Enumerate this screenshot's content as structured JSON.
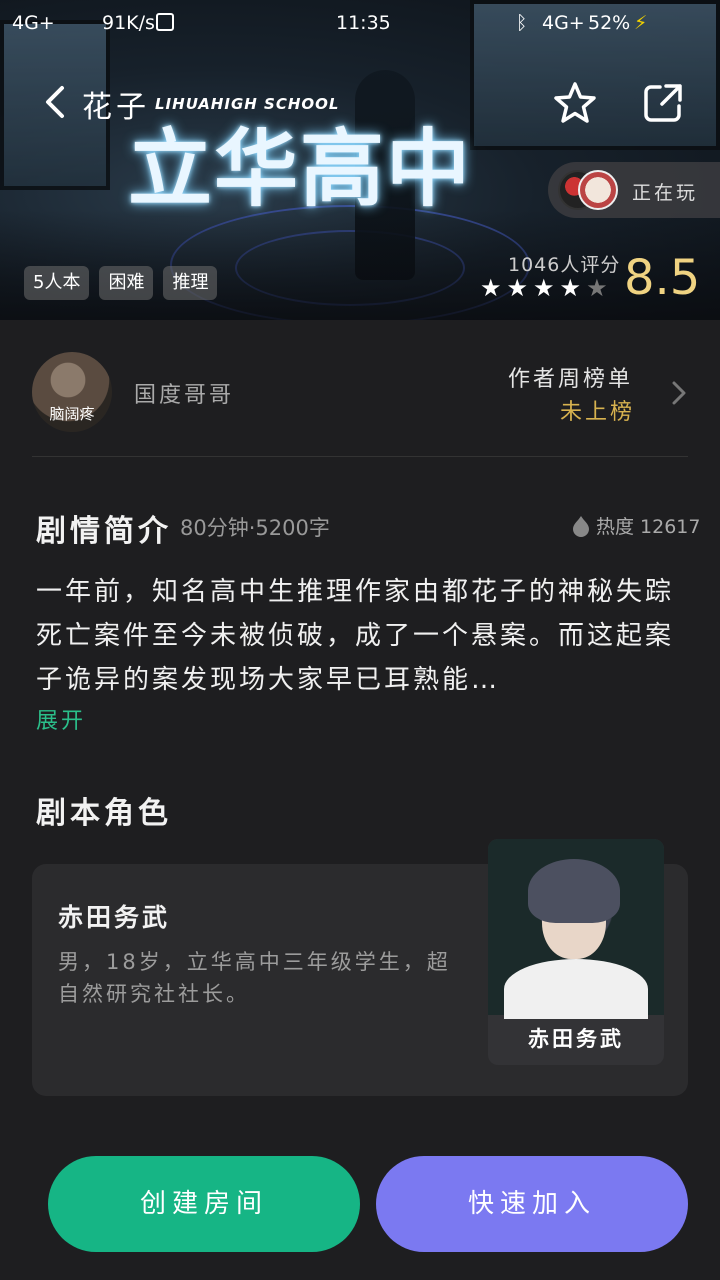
{
  "status_bar": {
    "network_left": "4G+",
    "speed": "91K/s",
    "time": "11:35",
    "network_right": "4G+",
    "battery": "52%"
  },
  "header": {
    "back_label": "花子",
    "subtitle": "LIHUAHIGH SCHOOL",
    "title": "立华高中",
    "now_playing": "正在玩",
    "tags": [
      "5人本",
      "困难",
      "推理"
    ],
    "rating_count": "1046人评分",
    "stars_on": 4,
    "stars_total": 5,
    "score": "8.5"
  },
  "author": {
    "avatar_text": "脑阔疼",
    "name": "国度哥哥",
    "weekly_label": "作者周榜单",
    "weekly_value": "未上榜"
  },
  "synopsis": {
    "title": "剧情简介",
    "meta": "80分钟·5200字",
    "heat": "热度 12617",
    "text": "一年前，知名高中生推理作家由都花子的神秘失踪死亡案件至今未被侦破，成了一个悬案。而这起案子诡异的案发现场大家早已耳熟能…",
    "expand": "展开"
  },
  "characters": {
    "title": "剧本角色",
    "items": [
      {
        "name": "赤田务武",
        "desc": "男，18岁，立华高中三年级学生，超自然研究社社长。",
        "photo_label": "赤田务武"
      }
    ]
  },
  "actions": {
    "create": "创建房间",
    "join": "快速加入"
  },
  "colors": {
    "accent_green": "#16b585",
    "accent_purple": "#7b79f1",
    "score_gold": "#f0d382",
    "rank_gold": "#d7b24f",
    "expand_green": "#2bbf8a"
  }
}
